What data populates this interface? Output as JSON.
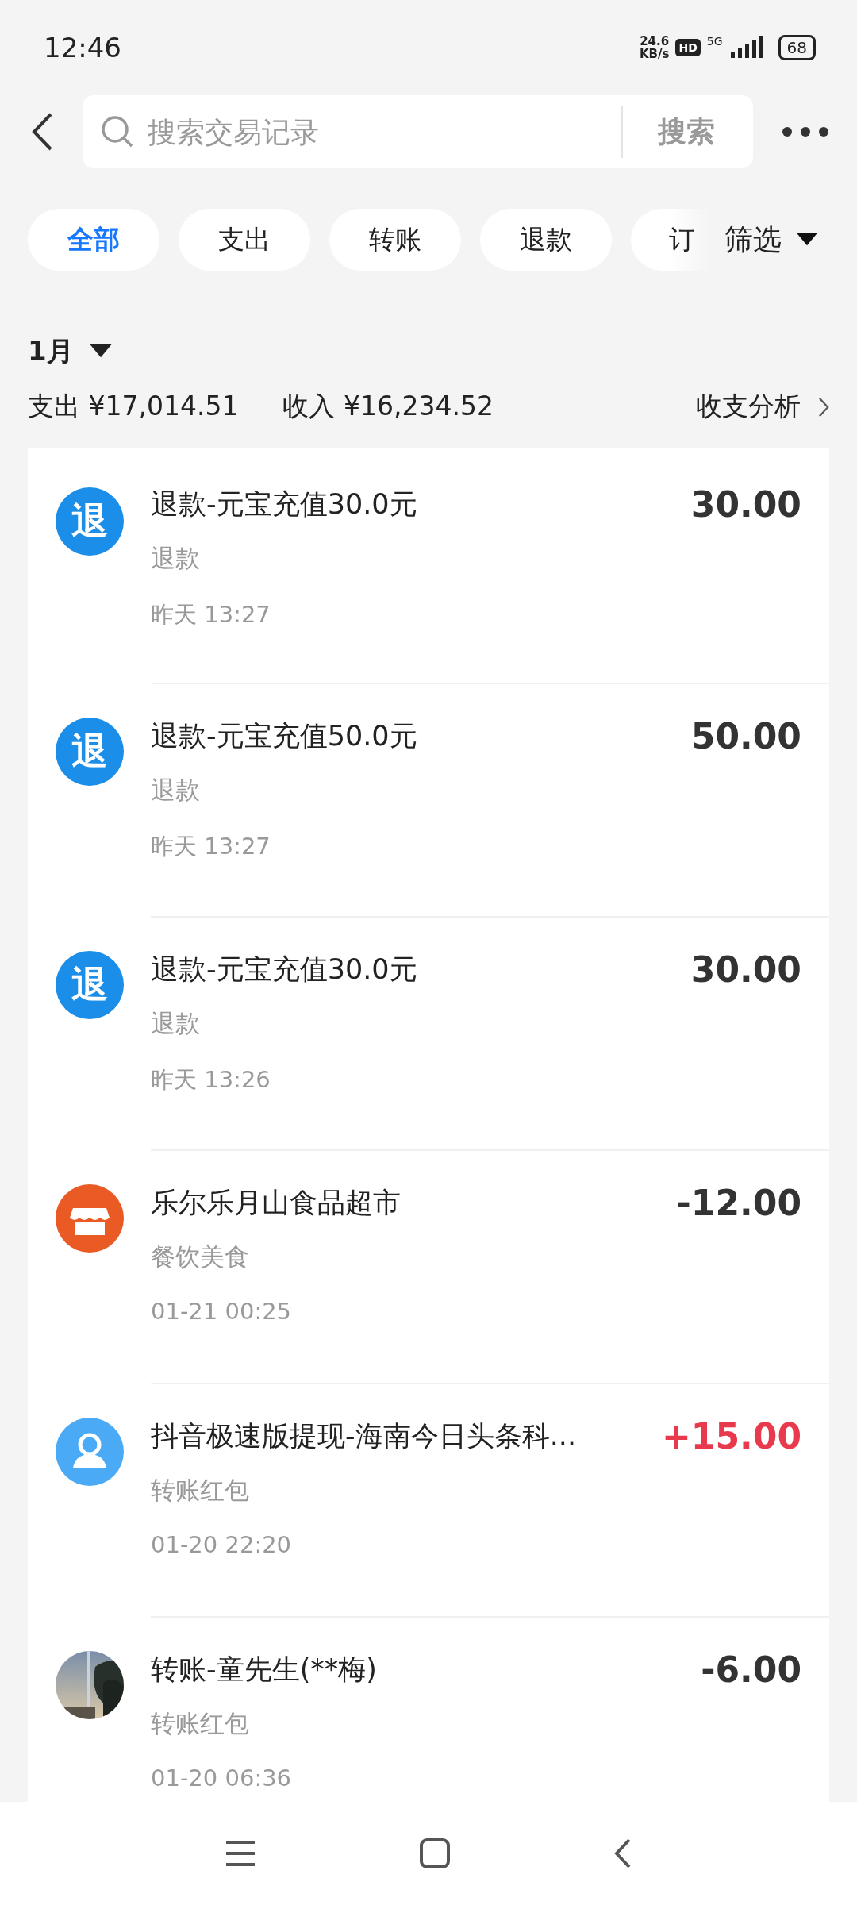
{
  "status_bar": {
    "time": "12:46",
    "speed_value": "24.6",
    "speed_unit": "KB/s",
    "hd": "HD",
    "network": "5G",
    "battery": "68"
  },
  "search": {
    "placeholder": "搜索交易记录",
    "button": "搜索"
  },
  "filters": [
    {
      "label": "全部",
      "selected": true
    },
    {
      "label": "支出",
      "selected": false
    },
    {
      "label": "转账",
      "selected": false
    },
    {
      "label": "退款",
      "selected": false
    },
    {
      "label": "订",
      "selected": false
    }
  ],
  "filter_button": "筛选",
  "month": "1月",
  "summary": {
    "expense": "支出 ¥17,014.51",
    "income": "收入 ¥16,234.52",
    "analysis": "收支分析"
  },
  "transactions": [
    {
      "kind": "refund",
      "icon_text": "退",
      "title": "退款-元宝充值30.0元",
      "category": "退款",
      "time": "昨天 13:27",
      "amount": "30.00",
      "color": "#333333"
    },
    {
      "kind": "refund",
      "icon_text": "退",
      "title": "退款-元宝充值50.0元",
      "category": "退款",
      "time": "昨天 13:27",
      "amount": "50.00",
      "color": "#333333"
    },
    {
      "kind": "refund",
      "icon_text": "退",
      "title": "退款-元宝充值30.0元",
      "category": "退款",
      "time": "昨天 13:26",
      "amount": "30.00",
      "color": "#333333"
    },
    {
      "kind": "shop",
      "title": "乐尔乐月山食品超市",
      "category": "餐饮美食",
      "time": "01-21 00:25",
      "amount": "-12.00",
      "color": "#333333"
    },
    {
      "kind": "person",
      "title": "抖音极速版提现-海南今日头条科...",
      "category": "转账红包",
      "time": "01-20 22:20",
      "amount": "+15.00",
      "color": "#e8394d"
    },
    {
      "kind": "picture",
      "title": "转账-童先生(**梅)",
      "category": "转账红包",
      "time": "01-20 06:36",
      "amount": "-6.00",
      "color": "#333333"
    }
  ]
}
